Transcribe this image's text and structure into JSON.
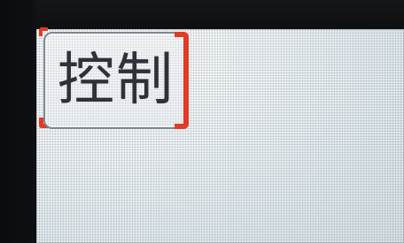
{
  "button": {
    "label": "控制"
  },
  "colors": {
    "screen_background": "#e8eef1",
    "button_border": "#7d8790",
    "label_text": "#2e3238",
    "selection_accent": "#e13a26",
    "bezel": "#0f1013"
  }
}
